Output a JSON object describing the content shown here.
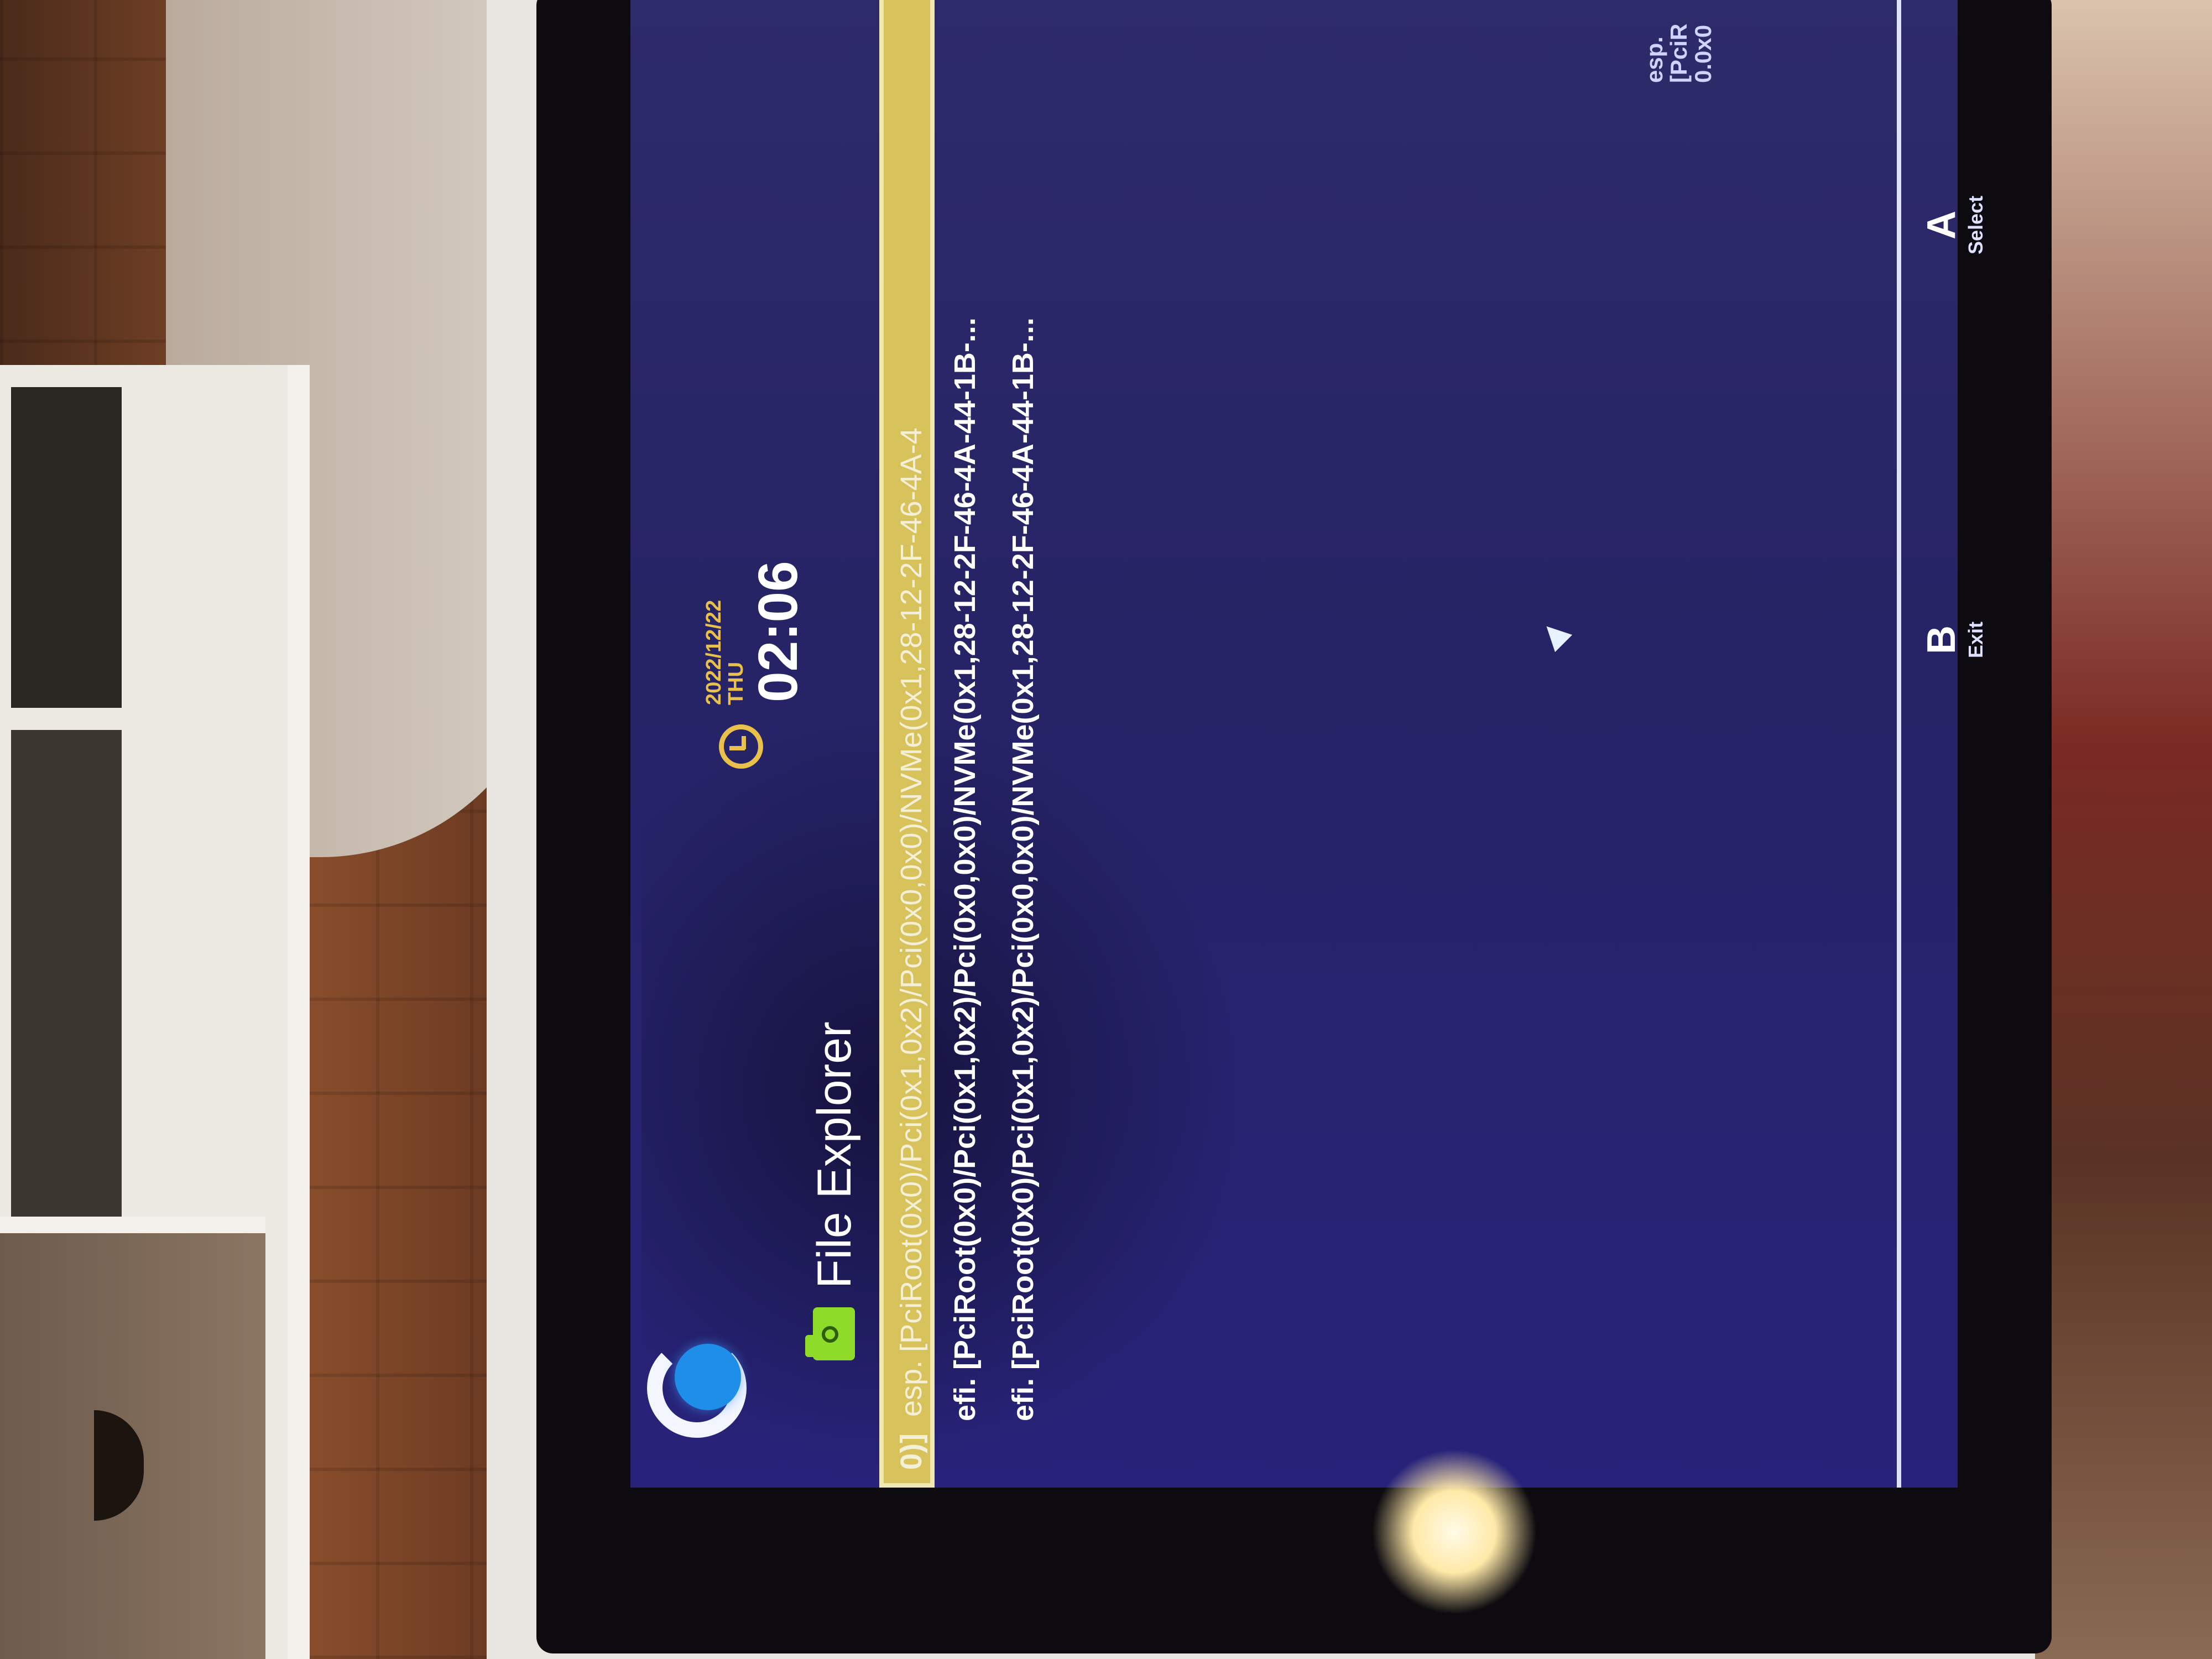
{
  "header": {
    "date": "2022/12/22",
    "weekday": "THU",
    "time": "02:06",
    "title": "File Explorer"
  },
  "entries": [
    {
      "prefix": "0)]",
      "text": "esp. [PciRoot(0x0)/Pci(0x1,0x2)/Pci(0x0,0x0)/NVMe(0x1,28-12-2F-46-4A-4",
      "selected": true
    },
    {
      "prefix": "",
      "text": "efi. [PciRoot(0x0)/Pci(0x1,0x2)/Pci(0x0,0x0)/NVMe(0x1,28-12-2F-46-4A-44-1B-...",
      "selected": false
    },
    {
      "prefix": "",
      "text": "efi. [PciRoot(0x0)/Pci(0x1,0x2)/Pci(0x0,0x0)/NVMe(0x1,28-12-2F-46-4A-44-1B-...",
      "selected": false
    }
  ],
  "side_preview": {
    "line1": "esp.",
    "line2": "[PciR",
    "line3": "0.0x0"
  },
  "hints": [
    {
      "key": "B",
      "label": "Exit"
    },
    {
      "key": "A",
      "label": "Select"
    }
  ],
  "colors": {
    "background": "#2a2670",
    "selection": "#d7c25c",
    "clock_accent": "#e8c04a",
    "folder_icon": "#8edb2a",
    "logo_dot": "#1e8ee8"
  }
}
